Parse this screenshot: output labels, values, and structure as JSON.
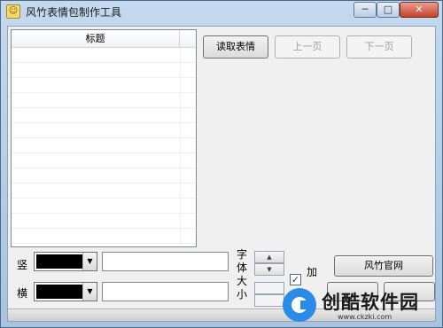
{
  "window": {
    "title": "风竹表情包制作工具",
    "icon": "app-icon",
    "controls": {
      "minimize": "─",
      "maximize": "□",
      "close": "✕"
    }
  },
  "list": {
    "column_header": "标题",
    "rows": []
  },
  "toolbar": {
    "read_label": "读取表情",
    "prev_label": "上一页",
    "next_label": "下一页"
  },
  "bottom": {
    "vertical_label": "竖",
    "horizontal_label": "横",
    "vertical_text": "",
    "horizontal_text": "",
    "font_size_label": "字体大小",
    "add_label": "加",
    "add_checked": true,
    "site_button": "风竹官网",
    "vertical_color": "#000000",
    "horizontal_color": "#000000"
  },
  "watermark": {
    "text": "创酷软件园",
    "url": "www.ckzki.com"
  }
}
